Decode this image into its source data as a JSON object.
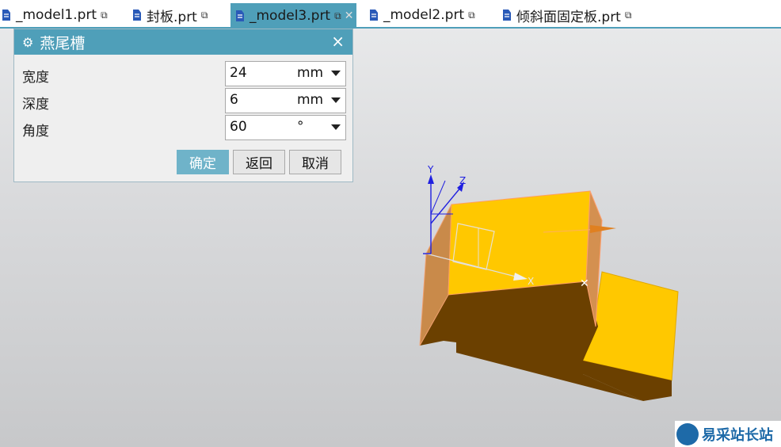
{
  "tabs": [
    {
      "label": "_model1.prt"
    },
    {
      "label": "封板.prt"
    },
    {
      "label": "_model3.prt",
      "active": true
    },
    {
      "label": "_model2.prt"
    },
    {
      "label": "倾斜面固定板.prt"
    }
  ],
  "dialog": {
    "title": "燕尾槽",
    "close_label": "×",
    "fields": [
      {
        "label": "宽度",
        "value": "24",
        "unit": "mm"
      },
      {
        "label": "深度",
        "value": "6",
        "unit": "mm"
      },
      {
        "label": "角度",
        "value": "60",
        "unit": "°"
      }
    ],
    "buttons": {
      "ok": "确定",
      "back": "返回",
      "cancel": "取消"
    }
  },
  "axes": {
    "x": "X",
    "y": "Y",
    "z": "Z"
  },
  "watermark": {
    "text": "易采站长站"
  },
  "colors": {
    "accent": "#4f9fb9",
    "face_top": "#ffc800",
    "face_side": "#6b4000",
    "face_edge": "#c07838",
    "axis_blue": "#2020e0"
  }
}
